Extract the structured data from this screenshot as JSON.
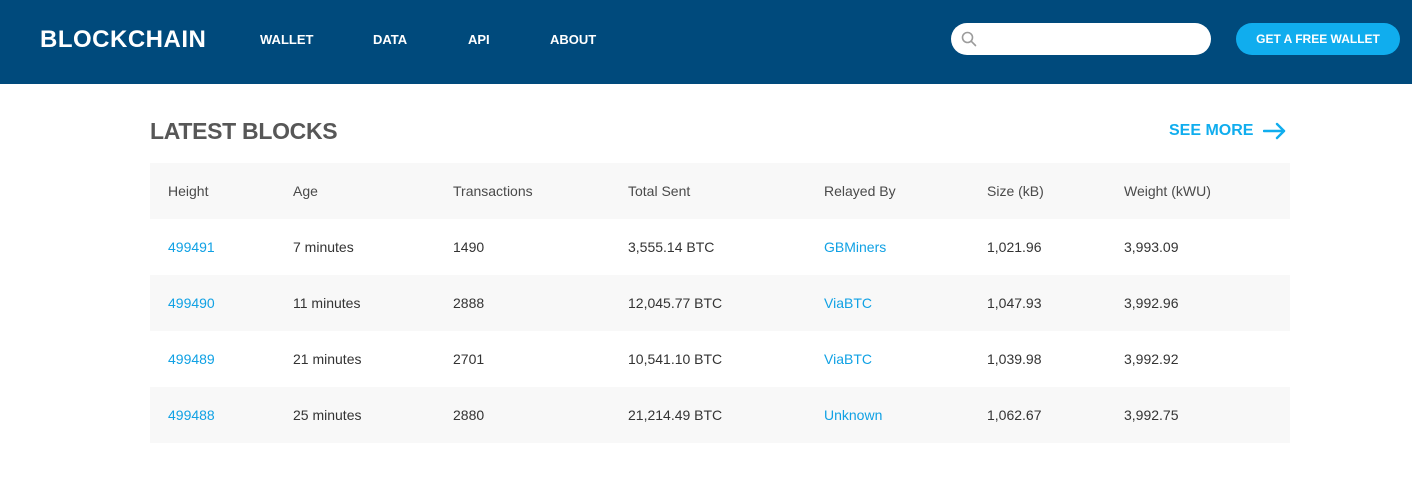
{
  "header": {
    "logo": "BLOCKCHAIN",
    "nav": [
      "WALLET",
      "DATA",
      "API",
      "ABOUT"
    ],
    "search": {
      "value": "",
      "placeholder": ""
    },
    "cta_label": "GET A FREE WALLET",
    "colors": {
      "bar": "#004a7c",
      "accent": "#10adee"
    }
  },
  "section": {
    "title": "LATEST BLOCKS",
    "see_more": "SEE MORE"
  },
  "table": {
    "columns": [
      "Height",
      "Age",
      "Transactions",
      "Total Sent",
      "Relayed By",
      "Size (kB)",
      "Weight (kWU)"
    ],
    "rows": [
      [
        "499491",
        "7 minutes",
        "1490",
        "3,555.14 BTC",
        "GBMiners",
        "1,021.96",
        "3,993.09"
      ],
      [
        "499490",
        "11 minutes",
        "2888",
        "12,045.77 BTC",
        "ViaBTC",
        "1,047.93",
        "3,992.96"
      ],
      [
        "499489",
        "21 minutes",
        "2701",
        "10,541.10 BTC",
        "ViaBTC",
        "1,039.98",
        "3,992.92"
      ],
      [
        "499488",
        "25 minutes",
        "2880",
        "21,214.49 BTC",
        "Unknown",
        "1,062.67",
        "3,992.75"
      ]
    ]
  }
}
